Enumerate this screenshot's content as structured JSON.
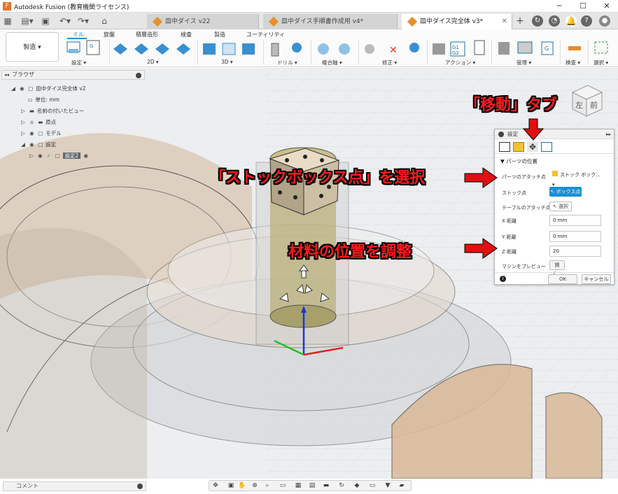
{
  "window": {
    "title": "Autodesk Fusion (教育機関ライセンス)"
  },
  "tabs": [
    {
      "label": "皿中ダイス v22"
    },
    {
      "label": "皿中ダイス手順書作成用 v4*"
    },
    {
      "label": "皿中ダイス完全体 v3*"
    }
  ],
  "ribbon": {
    "workspace": "製造 ▾",
    "tabs": [
      "ミル",
      "旋盤",
      "積層造形",
      "検査",
      "製造",
      "ユーティリティ"
    ],
    "groups": [
      "設定 ▾",
      "2D ▾",
      "3D ▾",
      "ドリル ▾",
      "複合軸 ▾",
      "修正 ▾",
      "アクション ▾",
      "管理 ▾",
      "検査 ▾",
      "選択 ▾"
    ]
  },
  "browser": {
    "title": "ブラウザ",
    "items": [
      {
        "label": "皿中ダイス完全体 v2"
      },
      {
        "label": "単位: mm"
      },
      {
        "label": "名前の付いたビュー"
      },
      {
        "label": "原点"
      },
      {
        "label": "モデル"
      },
      {
        "label": "設定"
      },
      {
        "label": "設定2"
      }
    ]
  },
  "comment": {
    "label": "コメント"
  },
  "viewcube": {
    "left": "左",
    "front": "前"
  },
  "setup_dialog": {
    "title": "設定",
    "section": "パーツの位置",
    "part_attach_label": "パーツのアタッチ点",
    "part_attach_value": "ストック ボック...",
    "stock_point_label": "ストック点",
    "stock_point_value": "ボックス点",
    "table_attach_label": "テーブルのアタッチ点",
    "table_attach_value": "選択",
    "x_label": "X 距離",
    "x_value": "0 mm",
    "y_label": "Y 距離",
    "y_value": "0 mm",
    "z_label": "Z 距離",
    "z_value": "20",
    "preview_label": "マシンをプレビュー",
    "preview_button": "開く...",
    "ok": "OK",
    "cancel": "キャンセル"
  },
  "annotations": {
    "move_tab": "「移動」タブ",
    "stock_box": "「ストックボックス点」を選択",
    "adjust": "材料の位置を調整"
  }
}
